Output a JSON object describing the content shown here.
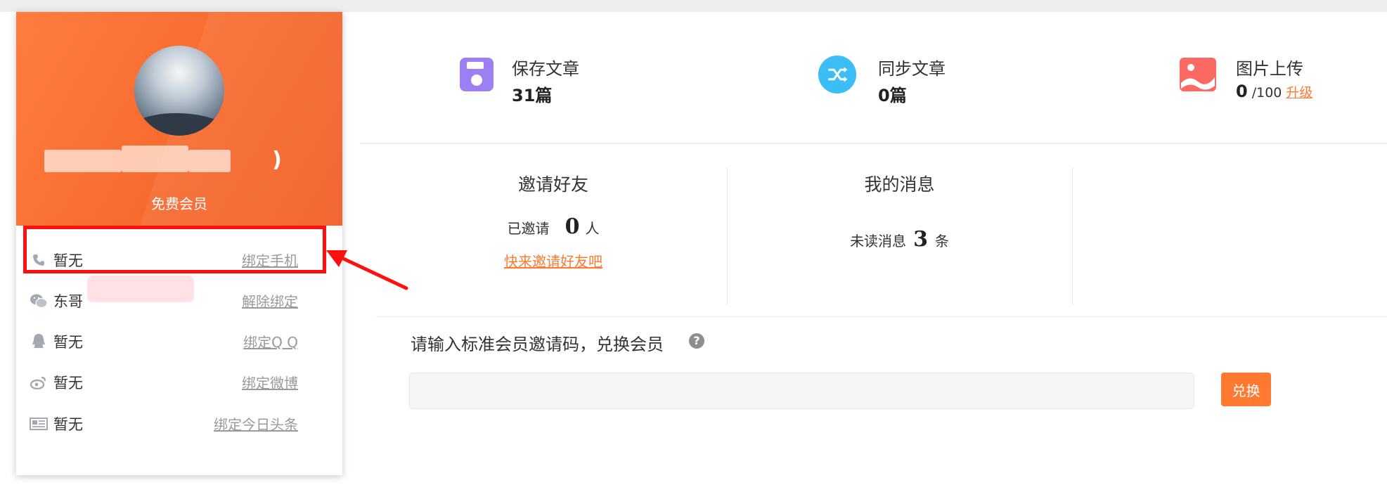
{
  "profile": {
    "username": ")",
    "level": "免费会员"
  },
  "bindings": [
    {
      "icon": "phone-icon",
      "status": "暂无",
      "action": "绑定手机"
    },
    {
      "icon": "wechat-icon",
      "status": "东哥",
      "action": "解除绑定"
    },
    {
      "icon": "qq-icon",
      "status": "暂无",
      "action": "绑定Q Q"
    },
    {
      "icon": "weibo-icon",
      "status": "暂无",
      "action": "绑定微博"
    },
    {
      "icon": "toutiao-icon",
      "status": "暂无",
      "action": "绑定今日头条"
    }
  ],
  "stats": {
    "saved": {
      "title": "保存文章",
      "value": "31篇",
      "icon": "save-icon",
      "color": "#9b7ff3"
    },
    "synced": {
      "title": "同步文章",
      "value": "0篇",
      "icon": "shuffle-icon",
      "color": "#3bbdf6"
    },
    "upload": {
      "title": "图片上传",
      "value": "0",
      "limit": "/100",
      "upgrade": "升级",
      "icon": "image-icon",
      "color": "#fb6a62"
    }
  },
  "invite": {
    "title": "邀请好友",
    "prefix": "已邀请",
    "count": "0",
    "unit": "人",
    "link": "快来邀请好友吧"
  },
  "messages": {
    "title": "我的消息",
    "prefix": "未读消息",
    "count": "3",
    "unit": "条"
  },
  "redeem": {
    "label": "请输入标准会员邀请码，兑换会员",
    "input_value": "",
    "button": "兑换"
  },
  "colors": {
    "accent": "#ff7a30",
    "highlight": "#ff1010"
  }
}
